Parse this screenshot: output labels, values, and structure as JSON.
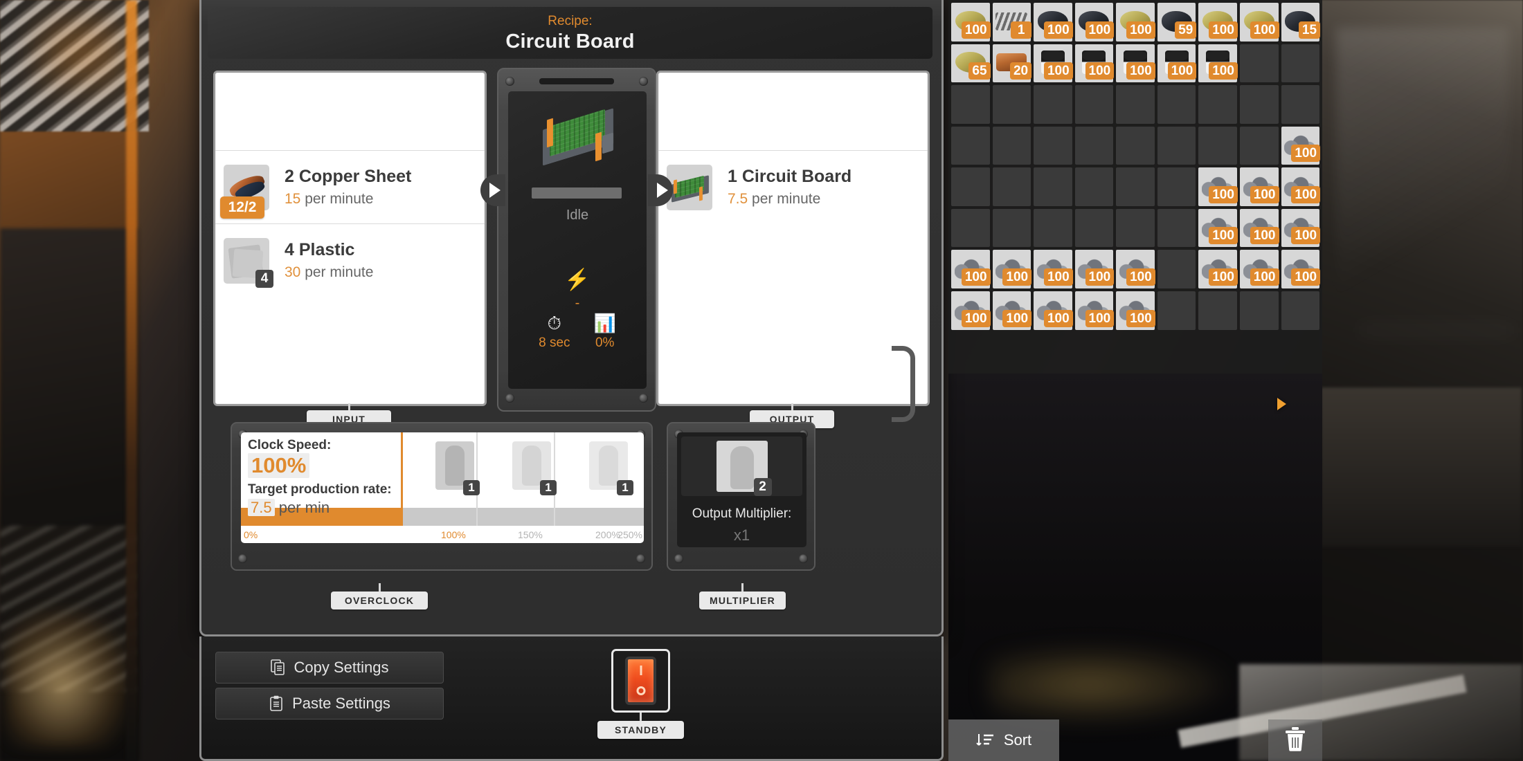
{
  "header": {
    "recipe_label": "Recipe:",
    "recipe_name": "Circuit Board"
  },
  "input": {
    "tab_label": "INPUT",
    "items": [
      {
        "name": "2 Copper Sheet",
        "rate_value": "15",
        "rate_unit": "per minute",
        "badge": "12/2",
        "icon": "copper-sheet-icon"
      },
      {
        "name": "4 Plastic",
        "rate_value": "30",
        "rate_unit": "per minute",
        "badge": "4",
        "icon": "plastic-icon"
      }
    ]
  },
  "output": {
    "tab_label": "OUTPUT",
    "items": [
      {
        "name": "1 Circuit Board",
        "rate_value": "7.5",
        "rate_unit": "per minute",
        "icon": "circuit-board-icon"
      }
    ]
  },
  "machine": {
    "status": "Idle",
    "power_value": "-",
    "cycle_time": "8 sec",
    "efficiency": "0%",
    "prev_label": "▶",
    "next_label": "▶"
  },
  "overclock": {
    "tab_label": "OVERCLOCK",
    "clock_speed_label": "Clock Speed:",
    "clock_speed_value": "100%",
    "target_rate_label": "Target production rate:",
    "target_rate_value": "7.5",
    "target_rate_unit": "per min",
    "slider_fill_percent": 100,
    "scale_ticks": [
      {
        "label": "0%",
        "lit": true
      },
      {
        "label": "100%",
        "lit": true
      },
      {
        "label": "150%",
        "lit": false
      },
      {
        "label": "200%",
        "lit": false
      },
      {
        "label": "250%",
        "lit": false
      }
    ],
    "shard_slots": [
      {
        "count": "1"
      },
      {
        "count": "1"
      },
      {
        "count": "1"
      }
    ]
  },
  "multiplier": {
    "tab_label": "MULTIPLIER",
    "label": "Output Multiplier:",
    "value": "x1",
    "slot_count": "2"
  },
  "footer": {
    "copy_label": "Copy Settings",
    "paste_label": "Paste Settings",
    "standby_tab_label": "STANDBY"
  },
  "inventory": {
    "columns": 9,
    "cells": [
      {
        "item": "ore-gold",
        "count": "100"
      },
      {
        "item": "beam",
        "count": "1"
      },
      {
        "item": "ore-coal",
        "count": "100"
      },
      {
        "item": "ore-coal",
        "count": "100"
      },
      {
        "item": "ore-gold",
        "count": "100"
      },
      {
        "item": "ore-coal",
        "count": "59"
      },
      {
        "item": "ore-gold",
        "count": "100"
      },
      {
        "item": "ore-gold",
        "count": "100"
      },
      {
        "item": "ore-coal",
        "count": "15"
      },
      {
        "item": "ore-gold",
        "count": "65"
      },
      {
        "item": "copper",
        "count": "20"
      },
      {
        "item": "canister",
        "count": "100"
      },
      {
        "item": "canister",
        "count": "100"
      },
      {
        "item": "canister",
        "count": "100"
      },
      {
        "item": "canister",
        "count": "100"
      },
      {
        "item": "canister",
        "count": "100"
      },
      {
        "item": null,
        "count": null
      },
      {
        "item": null,
        "count": null
      },
      {
        "item": null,
        "count": null
      },
      {
        "item": null,
        "count": null
      },
      {
        "item": null,
        "count": null
      },
      {
        "item": null,
        "count": null
      },
      {
        "item": null,
        "count": null
      },
      {
        "item": null,
        "count": null
      },
      {
        "item": null,
        "count": null
      },
      {
        "item": null,
        "count": null
      },
      {
        "item": null,
        "count": null
      },
      {
        "item": null,
        "count": null
      },
      {
        "item": null,
        "count": null
      },
      {
        "item": null,
        "count": null
      },
      {
        "item": null,
        "count": null
      },
      {
        "item": null,
        "count": null
      },
      {
        "item": null,
        "count": null
      },
      {
        "item": null,
        "count": null
      },
      {
        "item": null,
        "count": null
      },
      {
        "item": "rubble",
        "count": "100"
      },
      {
        "item": null,
        "count": null
      },
      {
        "item": null,
        "count": null
      },
      {
        "item": null,
        "count": null
      },
      {
        "item": null,
        "count": null
      },
      {
        "item": null,
        "count": null
      },
      {
        "item": null,
        "count": null
      },
      {
        "item": "rubble",
        "count": "100"
      },
      {
        "item": "rubble",
        "count": "100"
      },
      {
        "item": "rubble",
        "count": "100"
      },
      {
        "item": null,
        "count": null
      },
      {
        "item": null,
        "count": null
      },
      {
        "item": null,
        "count": null
      },
      {
        "item": null,
        "count": null
      },
      {
        "item": null,
        "count": null
      },
      {
        "item": null,
        "count": null
      },
      {
        "item": "rubble",
        "count": "100"
      },
      {
        "item": "rubble",
        "count": "100"
      },
      {
        "item": "rubble",
        "count": "100"
      },
      {
        "item": "rubble",
        "count": "100"
      },
      {
        "item": "rubble",
        "count": "100"
      },
      {
        "item": "rubble",
        "count": "100"
      },
      {
        "item": "rubble",
        "count": "100"
      },
      {
        "item": "rubble",
        "count": "100"
      },
      {
        "item": null,
        "count": null
      },
      {
        "item": "rubble",
        "count": "100"
      },
      {
        "item": "rubble",
        "count": "100"
      },
      {
        "item": "rubble",
        "count": "100"
      },
      {
        "item": "rubble",
        "count": "100"
      },
      {
        "item": "rubble",
        "count": "100"
      },
      {
        "item": "rubble",
        "count": "100"
      },
      {
        "item": "rubble",
        "count": "100"
      },
      {
        "item": "rubble",
        "count": "100"
      },
      {
        "item": null,
        "count": null
      },
      {
        "item": null,
        "count": null
      },
      {
        "item": null,
        "count": null
      },
      {
        "item": null,
        "count": null
      }
    ]
  },
  "inventory_footer": {
    "sort_label": "Sort",
    "trash_icon": "trash-icon"
  },
  "colors": {
    "accent": "#e08a2e",
    "panel_bg": "#2e2e2e",
    "card_bg": "#ffffff",
    "standby": "#ef4d1e"
  }
}
